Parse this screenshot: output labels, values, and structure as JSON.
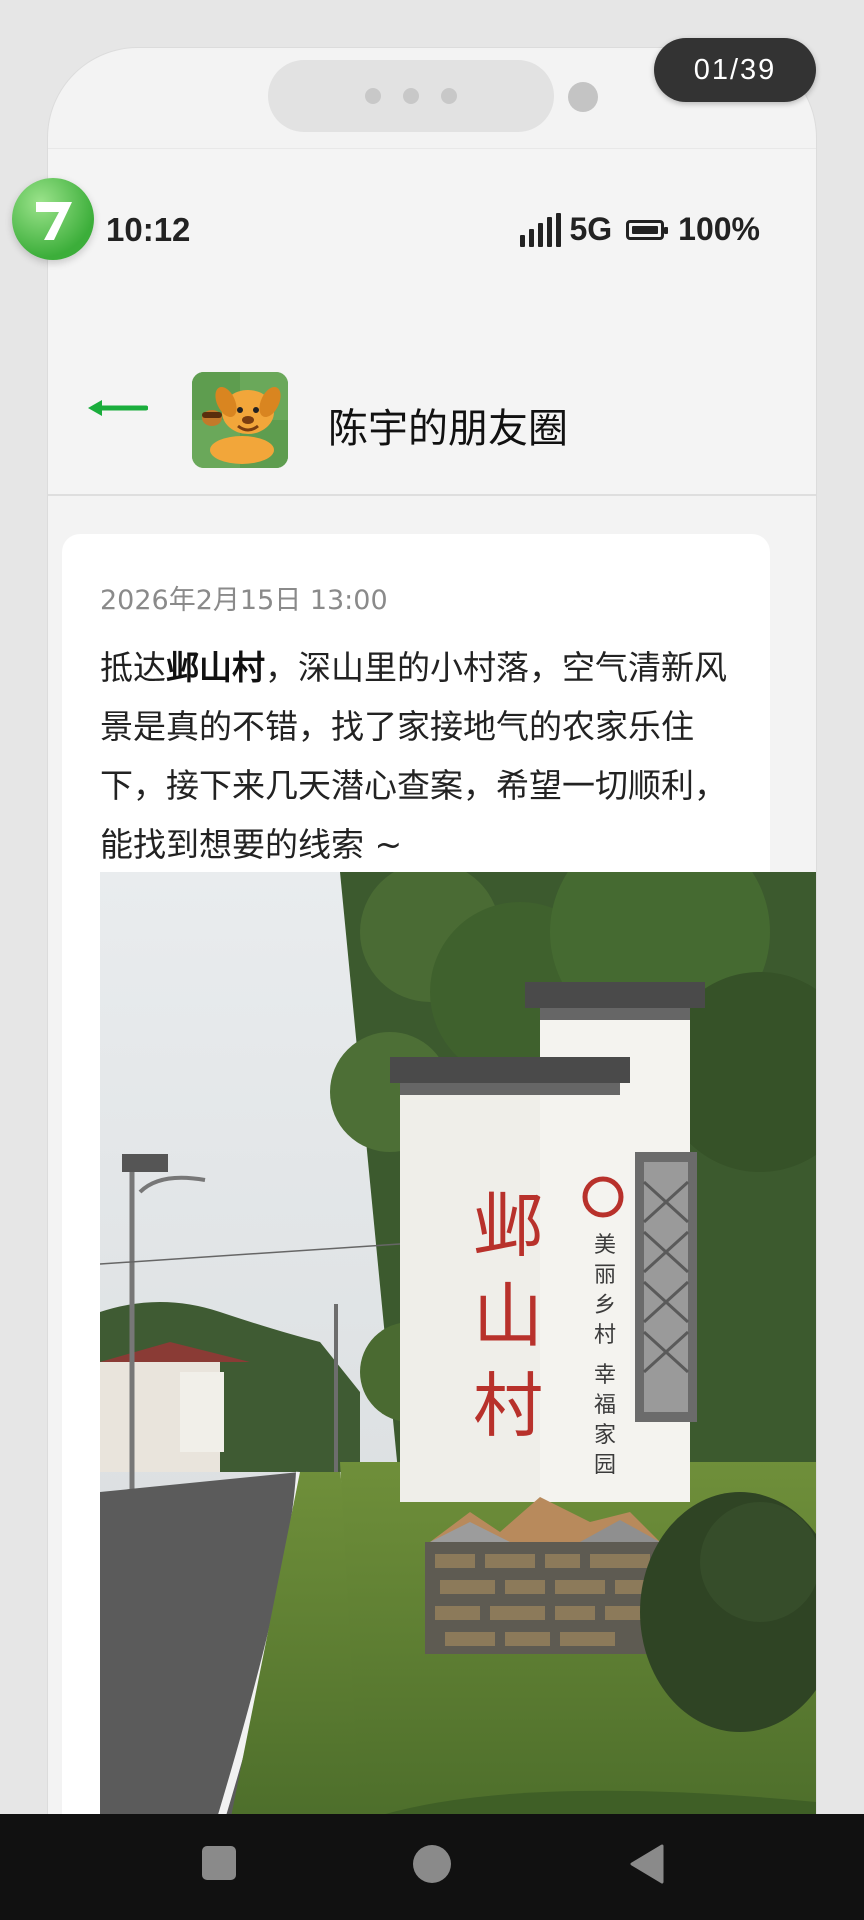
{
  "pager": {
    "current": "01",
    "separator": "/",
    "total": "39"
  },
  "status_bar": {
    "time": "10:12",
    "network": "5G",
    "battery": "100%"
  },
  "header": {
    "back_icon": "back-arrow-icon",
    "title": "陈宇的朋友圈"
  },
  "post": {
    "date": "2026年2月15日 13:00",
    "text_before": " 抵达",
    "text_bold": "邺山村",
    "text_after": "，深山里的小村落，空气清新风景是真的不错，找了家接地气的农家乐住下，接下来几天潜心查案，希望一切顺利，能找到想要的线索 ~",
    "photo": {
      "sign_name": [
        "邺",
        "山",
        "村"
      ],
      "slogan": [
        "美",
        "丽",
        "乡",
        "村",
        "幸",
        "福",
        "家",
        "园"
      ]
    }
  },
  "colors": {
    "accent": "#1aad3c",
    "sign_red": "#b8312b",
    "nav_bg": "#111111"
  },
  "nav_bar": {
    "icons": [
      "recent-apps-icon",
      "home-icon",
      "back-icon"
    ]
  }
}
